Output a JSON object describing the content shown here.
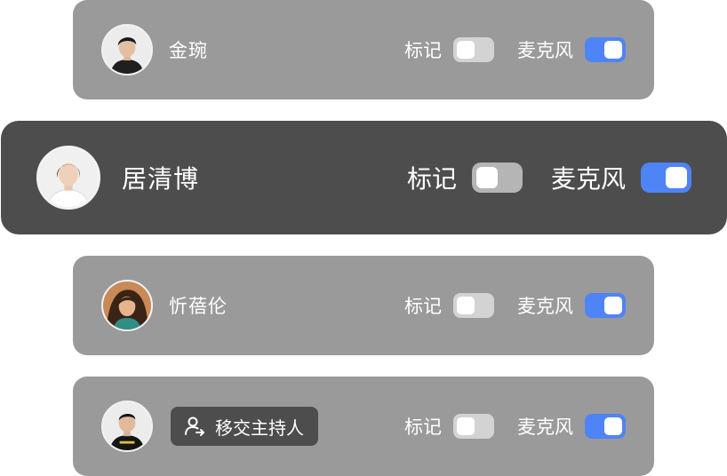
{
  "colors": {
    "card_bg": "#9a9a9a",
    "card_focused_bg": "#4d4d4d",
    "toggle_on": "#4f84f7",
    "toggle_off": "#d3d3d3"
  },
  "participants": [
    {
      "name": "金琬",
      "avatar": "avatar-male-1",
      "mark_label": "标记",
      "mark_on": false,
      "mic_label": "麦克风",
      "mic_on": true,
      "focused": false
    },
    {
      "name": "居清博",
      "avatar": "avatar-female-1",
      "mark_label": "标记",
      "mark_on": false,
      "mic_label": "麦克风",
      "mic_on": true,
      "focused": true
    },
    {
      "name": "忻蓓伦",
      "avatar": "avatar-female-2",
      "mark_label": "标记",
      "mark_on": false,
      "mic_label": "麦克风",
      "mic_on": true,
      "focused": false
    },
    {
      "transfer_host_label": "移交主持人",
      "transfer_icon": "user-transfer-icon",
      "avatar": "avatar-male-2",
      "mark_label": "标记",
      "mark_on": false,
      "mic_label": "麦克风",
      "mic_on": true,
      "focused": false
    }
  ]
}
